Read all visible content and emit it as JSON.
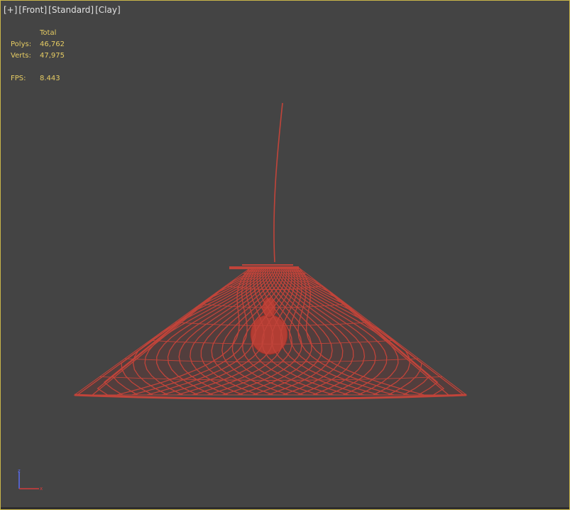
{
  "viewport": {
    "labels": [
      "[+]",
      "[Front]",
      "[Standard]",
      "[Clay]"
    ],
    "border_color": "#c9b64a",
    "background": "#444444"
  },
  "stats": {
    "header": "Total",
    "polys_label": "Polys:",
    "polys_value": "46,762",
    "verts_label": "Verts:",
    "verts_value": "47,975",
    "fps_label": "FPS:",
    "fps_value": "8.443",
    "text_color": "#e6cc63"
  },
  "model": {
    "object": "wicker pendant lamp shade",
    "color": "#c1443a"
  },
  "gizmo": {
    "axes": [
      "z-axis",
      "x-axis"
    ],
    "z_color": "#5a6cf0",
    "x_color": "#d43c3c"
  }
}
